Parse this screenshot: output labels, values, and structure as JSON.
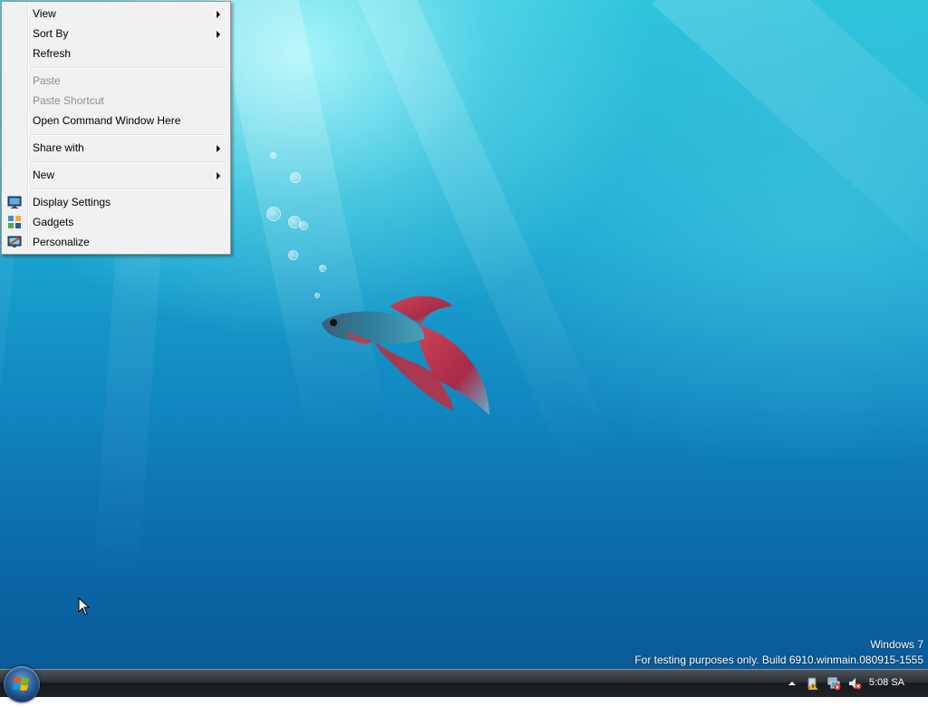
{
  "context_menu": {
    "items": [
      {
        "label": "View",
        "submenu": true,
        "enabled": true
      },
      {
        "label": "Sort By",
        "submenu": true,
        "enabled": true
      },
      {
        "label": "Refresh",
        "submenu": false,
        "enabled": true
      },
      {
        "label": "Paste",
        "submenu": false,
        "enabled": false
      },
      {
        "label": "Paste Shortcut",
        "submenu": false,
        "enabled": false
      },
      {
        "label": "Open Command Window Here",
        "submenu": false,
        "enabled": true
      },
      {
        "label": "Share with",
        "submenu": true,
        "enabled": true
      },
      {
        "label": "New",
        "submenu": true,
        "enabled": true
      },
      {
        "label": "Display Settings",
        "submenu": false,
        "enabled": true,
        "icon": "display-settings-icon"
      },
      {
        "label": "Gadgets",
        "submenu": false,
        "enabled": true,
        "icon": "gadgets-icon"
      },
      {
        "label": "Personalize",
        "submenu": false,
        "enabled": true,
        "icon": "personalize-icon"
      }
    ]
  },
  "watermark": {
    "line1": "Windows 7",
    "line2": "For testing purposes only. Build 6910.winmain.080915-1555"
  },
  "taskbar": {
    "start_icon": "windows-logo-icon",
    "tray_icons": [
      "show-hidden-icons-arrow-icon",
      "action-center-warning-icon",
      "network-disconnected-icon",
      "volume-muted-icon"
    ],
    "clock": "5:08 SA"
  },
  "colors": {
    "menu_bg": "#f1f1f1",
    "menu_disabled_text": "#8d8d8d",
    "taskbar_dark": "#202428",
    "desktop_blue": "#1187c0"
  }
}
